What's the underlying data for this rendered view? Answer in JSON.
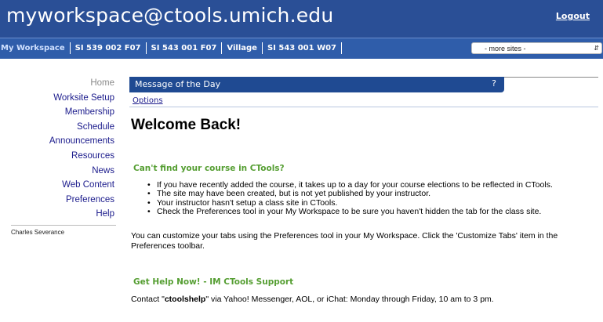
{
  "header": {
    "site_title": "myworkspace@ctools.umich.edu",
    "logout_label": "Logout"
  },
  "tabs": [
    {
      "label": "My Workspace",
      "current": true
    },
    {
      "label": "SI 539 002 F07"
    },
    {
      "label": "SI 543 001 F07"
    },
    {
      "label": "Village"
    },
    {
      "label": "SI 543 001 W07"
    }
  ],
  "more_sites": {
    "selected": "- more sites -"
  },
  "tool_menu": [
    {
      "label": "Home",
      "current": true
    },
    {
      "label": "Worksite Setup"
    },
    {
      "label": "Membership"
    },
    {
      "label": "Schedule"
    },
    {
      "label": "Announcements"
    },
    {
      "label": "Resources"
    },
    {
      "label": "News"
    },
    {
      "label": "Web Content"
    },
    {
      "label": "Preferences"
    },
    {
      "label": "Help"
    }
  ],
  "presence": {
    "user": "Charles Severance"
  },
  "portlet": {
    "title": "Message of the Day",
    "help": "?",
    "options": "Options"
  },
  "message": {
    "heading": "Welcome Back!",
    "subhead1": "Can't find your course in CTools?",
    "bullets": [
      "If you have recently added the course, it takes up to a day for your course elections to be reflected in CTools.",
      "The site may have been created, but is not yet published by your instructor.",
      "Your instructor hasn't setup a class site in CTools.",
      "Check the Preferences tool in your My Workspace to be sure you haven't hidden the tab for the class site."
    ],
    "paragraph": "You can customize your tabs using the Preferences tool in your My Workspace. Click the 'Customize Tabs' item in the Preferences toolbar.",
    "subhead2": "Get Help Now! - IM CTools Support",
    "contact_prefix": "Contact \"",
    "contact_handle": "ctoolshelp",
    "contact_suffix": "\" via Yahoo! Messenger, AOL, or iChat: Monday through Friday, 10 am to 3 pm."
  },
  "colors": {
    "header_bg": "#2a4f96",
    "tabbar_bg": "#2f5daa",
    "portlet_title_bg": "#1f4a92",
    "link": "#1b1b8c",
    "subhead_green": "#559e32"
  }
}
